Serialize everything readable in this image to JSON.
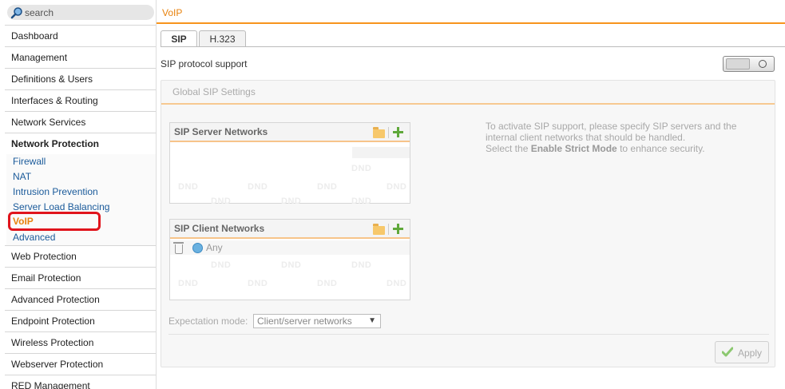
{
  "search": {
    "placeholder": "search"
  },
  "sidebar": {
    "items": [
      {
        "label": "Dashboard"
      },
      {
        "label": "Management"
      },
      {
        "label": "Definitions & Users"
      },
      {
        "label": "Interfaces & Routing"
      },
      {
        "label": "Network Services"
      },
      {
        "label": "Network Protection"
      },
      {
        "label": "Web Protection"
      },
      {
        "label": "Email Protection"
      },
      {
        "label": "Advanced Protection"
      },
      {
        "label": "Endpoint Protection"
      },
      {
        "label": "Wireless Protection"
      },
      {
        "label": "Webserver Protection"
      },
      {
        "label": "RED Management"
      }
    ],
    "subitems": [
      {
        "label": "Firewall"
      },
      {
        "label": "NAT"
      },
      {
        "label": "Intrusion Prevention"
      },
      {
        "label": "Server Load Balancing"
      },
      {
        "label": "VoIP"
      },
      {
        "label": "Advanced"
      }
    ]
  },
  "header": {
    "title": "VoIP"
  },
  "tabs": [
    {
      "label": "SIP"
    },
    {
      "label": "H.323"
    }
  ],
  "main": {
    "sip_support_label": "SIP protocol support",
    "global_title": "Global SIP Settings",
    "server_networks": {
      "title": "SIP Server Networks"
    },
    "client_networks": {
      "title": "SIP Client Networks",
      "entries": [
        {
          "label": "Any"
        }
      ]
    },
    "dnd_label": "DND",
    "info": {
      "line1": "To activate SIP support, please specify SIP servers and the",
      "line2": "internal client networks that should be handled.",
      "line3_prefix": "Select the ",
      "line3_bold": "Enable Strict Mode",
      "line3_suffix": " to enhance security."
    },
    "expectation_label": "Expectation mode:",
    "expectation_value": "Client/server networks",
    "apply_label": "Apply"
  },
  "colors": {
    "accent": "#f7941d",
    "active_nav": "#e8820c",
    "highlight": "#e0141c",
    "link": "#1a5a9a"
  }
}
